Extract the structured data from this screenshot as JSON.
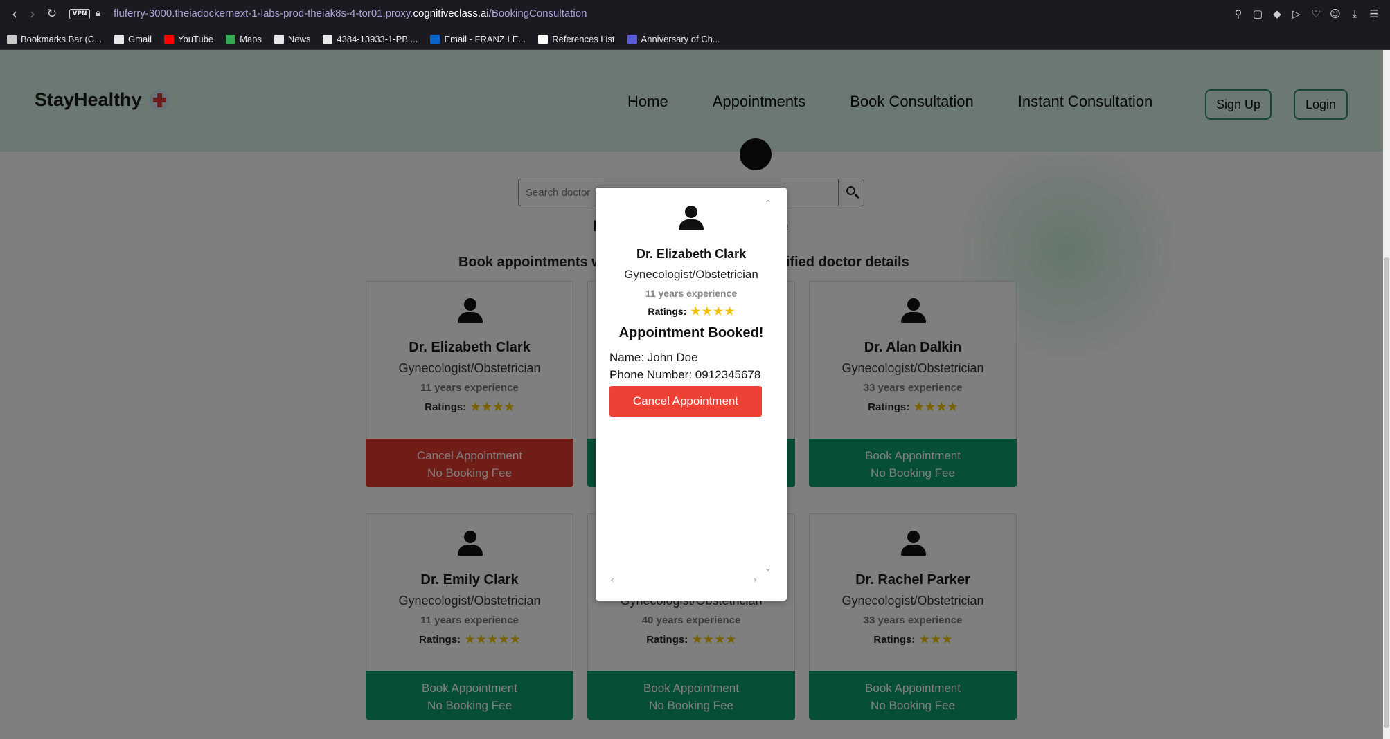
{
  "browser": {
    "url_prefix": "fluferry-3000.theiadockernext-1-labs-prod-theiak8s-4-tor01.proxy.",
    "url_host": "cognitiveclass.ai",
    "url_path": "/BookingConsultation",
    "vpn_label": "VPN",
    "bookmarks": [
      {
        "label": "Bookmarks Bar (C...",
        "icon": "folder-icon",
        "color": "#c9c9c9"
      },
      {
        "label": "Gmail",
        "icon": "document-icon",
        "color": "#e8e8e8"
      },
      {
        "label": "YouTube",
        "icon": "youtube-icon",
        "color": "#ff0000"
      },
      {
        "label": "Maps",
        "icon": "maps-pin-icon",
        "color": "#34a853"
      },
      {
        "label": "News",
        "icon": "document-icon",
        "color": "#e8e8e8"
      },
      {
        "label": "4384-13933-1-PB....",
        "icon": "document-icon",
        "color": "#e8e8e8"
      },
      {
        "label": "Email - FRANZ LE...",
        "icon": "outlook-icon",
        "color": "#0a64c8"
      },
      {
        "label": "References List",
        "icon": "notion-icon",
        "color": "#ffffff"
      },
      {
        "label": "Anniversary of Ch...",
        "icon": "calendar-icon",
        "color": "#5b5bd6"
      }
    ]
  },
  "header": {
    "brand": "StayHealthy",
    "nav": [
      "Home",
      "Appointments",
      "Book Consultation",
      "Instant Consultation"
    ],
    "signup": "Sign Up",
    "login": "Login"
  },
  "search": {
    "placeholder": "Search doctor"
  },
  "page": {
    "headline_left": "F",
    "headline_right": "e",
    "subline_left": "Book appointments w",
    "subline_right": "erified doctor details"
  },
  "doctors": [
    {
      "name": "Dr. Elizabeth Clark",
      "specialty": "Gynecologist/Obstetrician",
      "experience": "11 years experience",
      "ratings_label": "Ratings:",
      "stars": 4,
      "btn_line1": "Cancel Appointment",
      "btn_line2": "No Booking Fee",
      "booked": true
    },
    {
      "name": "",
      "specialty": "",
      "experience": "",
      "ratings_label": "",
      "stars": 0,
      "btn_line1": "",
      "btn_line2": "",
      "booked": false
    },
    {
      "name": "Dr. Alan Dalkin",
      "specialty": "Gynecologist/Obstetrician",
      "experience": "33 years experience",
      "ratings_label": "Ratings:",
      "stars": 4,
      "btn_line1": "Book Appointment",
      "btn_line2": "No Booking Fee",
      "booked": false
    },
    {
      "name": "Dr. Emily Clark",
      "specialty": "Gynecologist/Obstetrician",
      "experience": "11 years experience",
      "ratings_label": "Ratings:",
      "stars": 5,
      "btn_line1": "Book Appointment",
      "btn_line2": "No Booking Fee",
      "booked": false
    },
    {
      "name": "",
      "specialty": "Gynecologist/Obstetrician",
      "experience": "40 years experience",
      "ratings_label": "Ratings:",
      "stars": 4,
      "btn_line1": "Book Appointment",
      "btn_line2": "No Booking Fee",
      "booked": false
    },
    {
      "name": "Dr. Rachel Parker",
      "specialty": "Gynecologist/Obstetrician",
      "experience": "33 years experience",
      "ratings_label": "Ratings:",
      "stars": 3,
      "btn_line1": "Book Appointment",
      "btn_line2": "No Booking Fee",
      "booked": false
    }
  ],
  "modal": {
    "name": "Dr. Elizabeth Clark",
    "specialty": "Gynecologist/Obstetrician",
    "experience": "11 years experience",
    "ratings_label": "Ratings:",
    "stars": 4,
    "status": "Appointment Booked!",
    "patient_name": "Name: John Doe",
    "phone": "Phone Number: 0912345678",
    "cancel_label": "Cancel Appointment"
  },
  "colors": {
    "header_bg": "#d7f3e5",
    "book_green": "#0f9d6e",
    "cancel_red": "#e33b2e",
    "star_gold": "#f2c200"
  }
}
